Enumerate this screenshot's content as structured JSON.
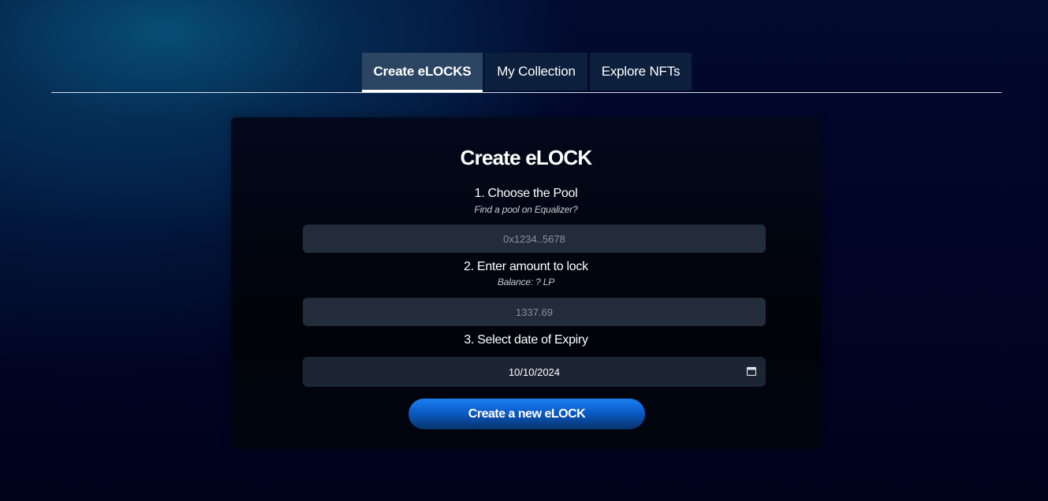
{
  "tabs": [
    {
      "label": "Create eLOCKS",
      "active": true
    },
    {
      "label": "My Collection",
      "active": false
    },
    {
      "label": "Explore NFTs",
      "active": false
    }
  ],
  "card": {
    "title": "Create eLOCK",
    "step1": {
      "label": "1. Choose the Pool",
      "hint": "Find a pool on Equalizer?",
      "placeholder": "0x1234..5678"
    },
    "step2": {
      "label": "2. Enter amount to lock",
      "hint": "Balance: ? LP",
      "placeholder": "1337.69"
    },
    "step3": {
      "label": "3. Select date of Expiry",
      "value": "10/10/2024",
      "icon": "calendar-icon"
    },
    "submit_label": "Create a new eLOCK"
  },
  "colors": {
    "accent": "#0b5bc8",
    "tab_active": "#2b4563",
    "field_bg": "#232c3b"
  }
}
